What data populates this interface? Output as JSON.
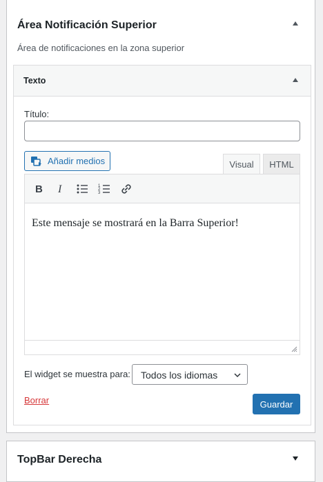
{
  "widget_area": {
    "title": "Área Notificación Superior",
    "description": "Área de notificaciones en la zona superior",
    "toggle_state": "expanded"
  },
  "text_widget": {
    "title": "Texto",
    "title_label": "Título:",
    "title_value": "",
    "add_media_label": "Añadir medios",
    "tabs": [
      "Visual",
      "HTML"
    ],
    "active_tab": "Visual",
    "toolbar": [
      "bold-icon",
      "italic-icon",
      "bullet-list-icon",
      "numbered-list-icon",
      "link-icon"
    ],
    "content": "Este mensaje se mostrará en la Barra Superior!",
    "language_label": "El widget se muestra para:",
    "language_value": "Todos los idiomas",
    "delete_label": "Borrar",
    "save_label": "Guardar"
  },
  "next_area": {
    "title": "TopBar Derecha",
    "toggle_state": "collapsed"
  },
  "colors": {
    "accent": "#2271b1",
    "danger": "#d63638",
    "border": "#c3c4c7",
    "background": "#f0f0f1"
  }
}
